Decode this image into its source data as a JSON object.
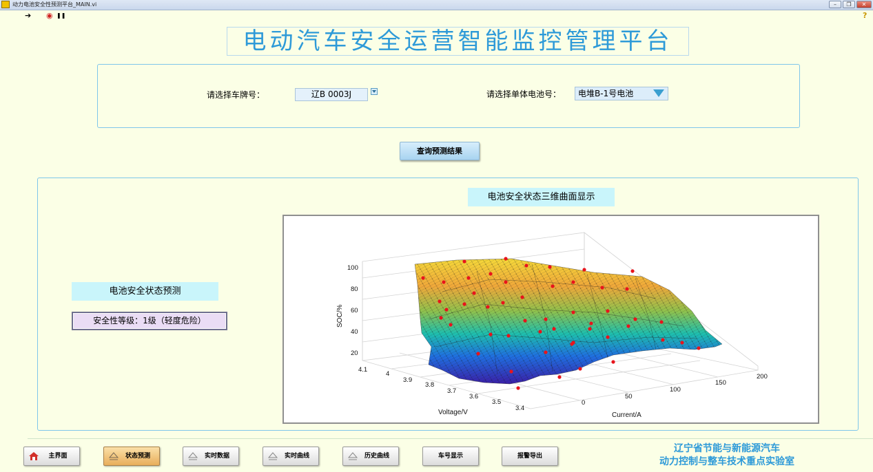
{
  "window": {
    "title": "动力电池安全性预测平台_MAIN.vi",
    "minimize": "–",
    "restore": "❐",
    "close": "✕"
  },
  "toolbar": {
    "run": "➔",
    "stop": "◉",
    "pause": "❚❚",
    "help": "?"
  },
  "header": {
    "title": "电动汽车安全运营智能监控管理平台"
  },
  "selectors": {
    "plate_label": "请选择车牌号：",
    "plate_value": "辽B 0003J",
    "battery_label": "请选择单体电池号：",
    "battery_value": "电堆B-1号电池"
  },
  "query_button": "查询预测结果",
  "surface": {
    "title": "电池安全状态三维曲面显示",
    "z_label": "SOC/%",
    "y_label": "Voltage/V",
    "x_label": "Current/A",
    "z_ticks": [
      "100",
      "80",
      "60",
      "40",
      "20"
    ],
    "y_ticks": [
      "4.1",
      "4",
      "3.9",
      "3.8",
      "3.7",
      "3.6",
      "3.5",
      "3.4"
    ],
    "x_ticks": [
      "0",
      "50",
      "100",
      "150",
      "200"
    ]
  },
  "prediction": {
    "label": "电池安全状态预测",
    "level": "安全性等级：1级（轻度危险）"
  },
  "nav": [
    {
      "label": "主界面"
    },
    {
      "label": "状态预测"
    },
    {
      "label": "实时数据"
    },
    {
      "label": "实时曲线"
    },
    {
      "label": "历史曲线"
    },
    {
      "label": "车号显示"
    },
    {
      "label": "报警导出"
    }
  ],
  "lab": {
    "line1": "辽宁省节能与新能源汽车",
    "line2": "动力控制与整车技术重点实验室"
  },
  "colors": {
    "accent": "#2e9ad8",
    "panel_border": "#7ec6ea",
    "label_bg": "#c9f5fb",
    "active_tab": "#e8ae5b",
    "data_point": "#e8141c"
  }
}
